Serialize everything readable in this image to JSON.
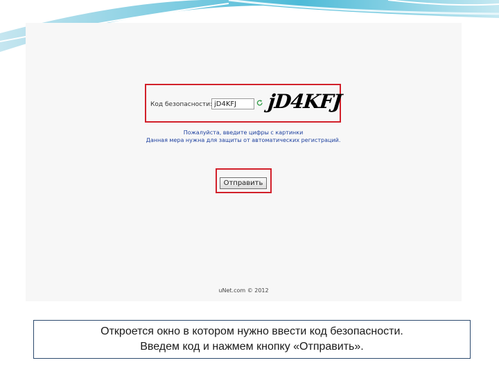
{
  "screen": {
    "captcha": {
      "label": "Код безопасности:",
      "input_value": "jD4KFJ",
      "image_text": "jD4KFJ",
      "refresh_icon": "refresh-icon"
    },
    "hint": {
      "line1": "Пожалуйста, введите цифры с картинки",
      "line2": "Данная мера нужна для защиты от автоматических регистраций."
    },
    "submit_label": "Отправить",
    "footer": "uNet.com © 2012"
  },
  "caption": {
    "line1": "Откроется окно в котором нужно ввести код безопасности.",
    "line2": "Введем код и нажмем кнопку «Отправить»."
  },
  "colors": {
    "highlight_frame": "#d2202a",
    "hint_text": "#1c3f9e",
    "slide_accent": "#41b4d2",
    "caption_border": "#2c4a6e"
  }
}
